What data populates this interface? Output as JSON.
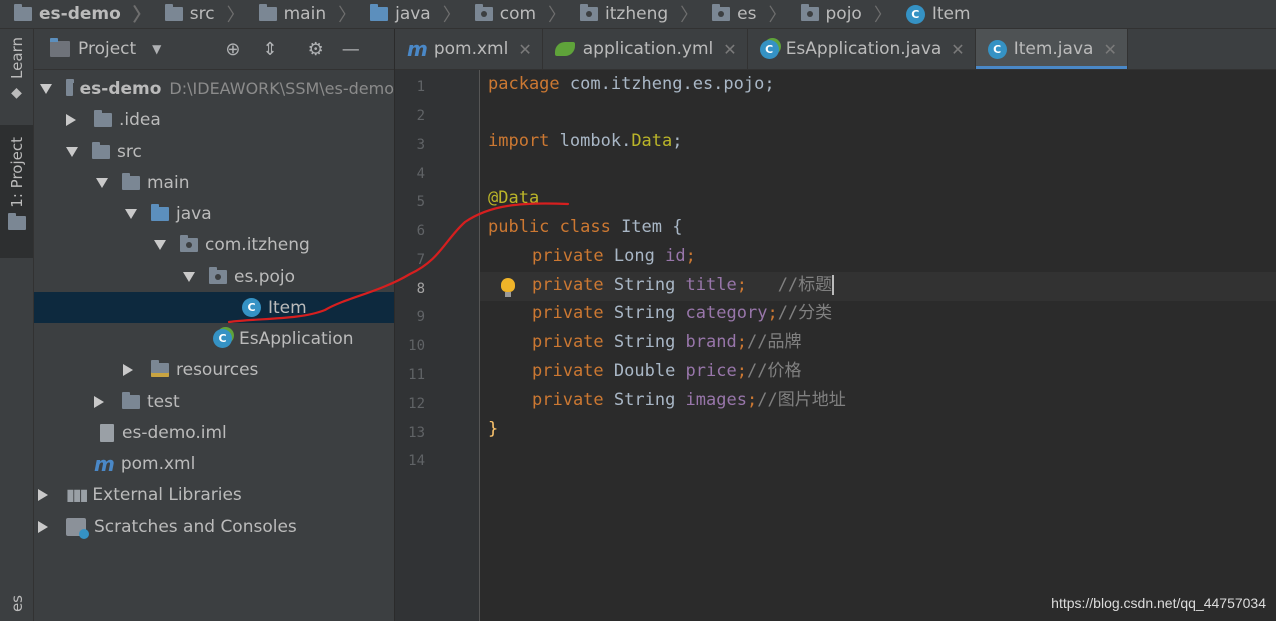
{
  "breadcrumb": [
    "es-demo",
    "src",
    "main",
    "java",
    "com",
    "itzheng",
    "es",
    "pojo",
    "Item"
  ],
  "left_strip": {
    "learn": "Learn",
    "project": "1: Project",
    "bottom": "es"
  },
  "project_panel": {
    "title": "Project",
    "tree": [
      {
        "label": "es-demo",
        "extra": "D:\\IDEAWORK\\SSM\\es-demo"
      },
      {
        "label": ".idea"
      },
      {
        "label": "src"
      },
      {
        "label": "main"
      },
      {
        "label": "java"
      },
      {
        "label": "com.itzheng"
      },
      {
        "label": "es.pojo"
      },
      {
        "label": "Item"
      },
      {
        "label": "EsApplication"
      },
      {
        "label": "resources"
      },
      {
        "label": "test"
      },
      {
        "label": "es-demo.iml"
      },
      {
        "label": "pom.xml"
      },
      {
        "label": "External Libraries"
      },
      {
        "label": "Scratches and Consoles"
      }
    ]
  },
  "tabs": [
    {
      "label": "pom.xml"
    },
    {
      "label": "application.yml"
    },
    {
      "label": "EsApplication.java"
    },
    {
      "label": "Item.java"
    }
  ],
  "editor": {
    "line_numbers": [
      "1",
      "2",
      "3",
      "4",
      "5",
      "6",
      "7",
      "8",
      "9",
      "10",
      "11",
      "12",
      "13",
      "14"
    ],
    "lines": {
      "l1": {
        "kw": "package",
        "rest": " com.itzheng.es.pojo;"
      },
      "l3": {
        "kw": "import",
        "pkg": " lombok.",
        "ann": "Data",
        "end": ";"
      },
      "l5": {
        "ann": "@Data"
      },
      "l6": {
        "kw": "public class",
        "rest": " Item {"
      },
      "l7": {
        "kw": "private",
        "type": " Long ",
        "field": "id",
        "end": ";"
      },
      "l8": {
        "kw": "private",
        "type": " String ",
        "field": "title",
        "end": ";",
        "comment": "   //标题"
      },
      "l9": {
        "kw": "private",
        "type": " String ",
        "field": "category",
        "end": ";",
        "comment": "//分类"
      },
      "l10": {
        "kw": "private",
        "type": " String ",
        "field": "brand",
        "end": ";",
        "comment": "//品牌"
      },
      "l11": {
        "kw": "private",
        "type": " Double ",
        "field": "price",
        "end": ";",
        "comment": "//价格"
      },
      "l12": {
        "kw": "private",
        "type": " String ",
        "field": "images",
        "end": ";",
        "comment": "//图片地址"
      },
      "l13": {
        "rest": "}"
      }
    }
  },
  "watermark": "https://blog.csdn.net/qq_44757034",
  "colors": {
    "keyword": "#cc7832",
    "annotation": "#bbb529",
    "field": "#9876aa",
    "comment": "#808080",
    "selection": "#0d293e",
    "tab_underline": "#4a88c7"
  }
}
